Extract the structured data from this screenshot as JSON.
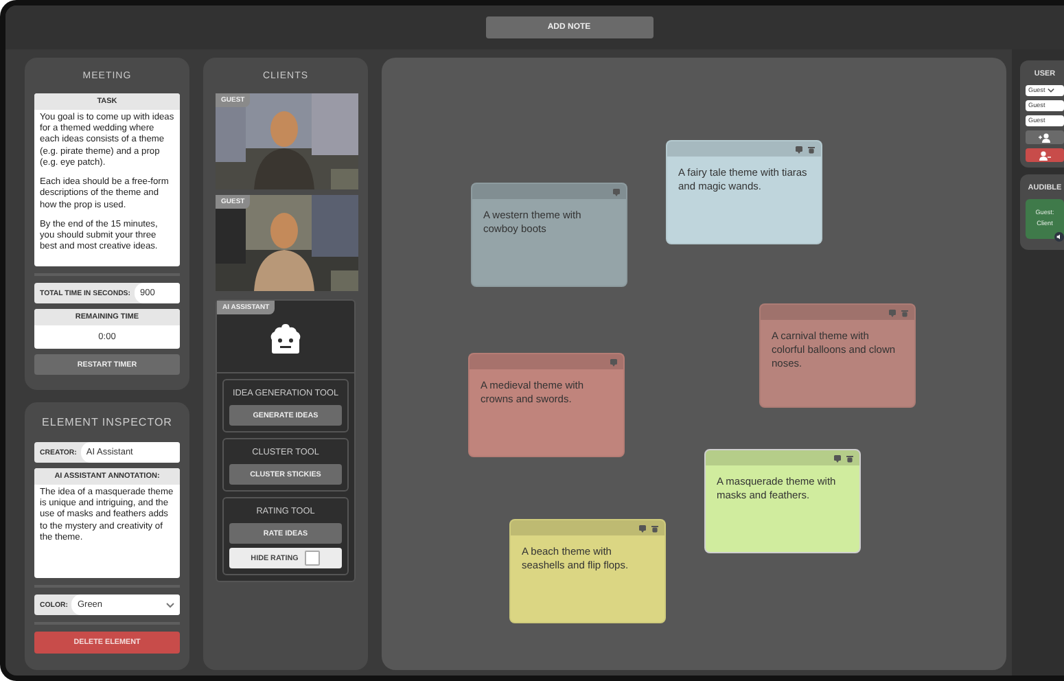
{
  "toolbar": {
    "add_note": "ADD NOTE"
  },
  "meeting": {
    "title": "MEETING",
    "task_label": "TASK",
    "task_paragraphs": [
      "You goal is to come up with ideas for a themed wedding where each ideas consists of a theme (e.g. pirate theme) and a prop (e.g. eye patch).",
      "Each idea should be a free-form descriptions of the theme and how the prop is used.",
      "By the end of the 15 minutes, you should submit your three best and most creative ideas."
    ],
    "total_time_label": "TOTAL TIME IN SECONDS:",
    "total_time_value": "900",
    "remaining_label": "REMAINING TIME",
    "remaining_value": "0:00",
    "restart": "RESTART TIMER"
  },
  "inspector": {
    "title": "ELEMENT INSPECTOR",
    "creator_label": "CREATOR:",
    "creator_value": "AI Assistant",
    "annotation_label": "AI ASSISTANT ANNOTATION:",
    "annotation": "The idea of a masquerade theme is unique and intriguing, and the use of masks and feathers adds to the mystery and creativity of the theme.",
    "color_label": "COLOR:",
    "color_value": "Green",
    "delete": "DELETE ELEMENT"
  },
  "clients": {
    "title": "CLIENTS",
    "videos": [
      {
        "label": "GUEST",
        "kind": "picture"
      },
      {
        "label": "GUEST",
        "kind": "picture"
      }
    ],
    "assistant_label": "AI ASSISTANT",
    "tools": [
      {
        "title": "IDEA GENERATION TOOL",
        "button": "GENERATE IDEAS"
      },
      {
        "title": "CLUSTER TOOL",
        "button": "CLUSTER STICKIES"
      },
      {
        "title": "RATING TOOL",
        "button": "RATE IDEAS",
        "toggle_label": "HIDE RATING",
        "toggle_checked": false
      }
    ]
  },
  "notes": [
    {
      "text": "A western theme with cowboy boots",
      "color": "#95a4a8",
      "deletable": false,
      "selected": false
    },
    {
      "text": "A fairy tale theme with tiaras and magic wands.",
      "color": "#bfd5dc",
      "deletable": true,
      "selected": false
    },
    {
      "text": "A carnival theme with colorful balloons and clown noses.",
      "color": "#b7837c",
      "deletable": true,
      "selected": false
    },
    {
      "text": "A medieval theme with crowns and swords.",
      "color": "#c0847c",
      "deletable": false,
      "selected": false
    },
    {
      "text": "A masquerade theme with masks and feathers.",
      "color": "#d0ec9e",
      "deletable": true,
      "selected": true
    },
    {
      "text": "A beach theme with seashells and flip flops.",
      "color": "#dbd683",
      "deletable": true,
      "selected": false
    }
  ],
  "user": {
    "title": "USER",
    "role": "Guest",
    "name_1": "Guest",
    "name_2": "Guest"
  },
  "audible": {
    "title": "AUDIBLE",
    "entries": [
      "Guest: Client"
    ]
  }
}
